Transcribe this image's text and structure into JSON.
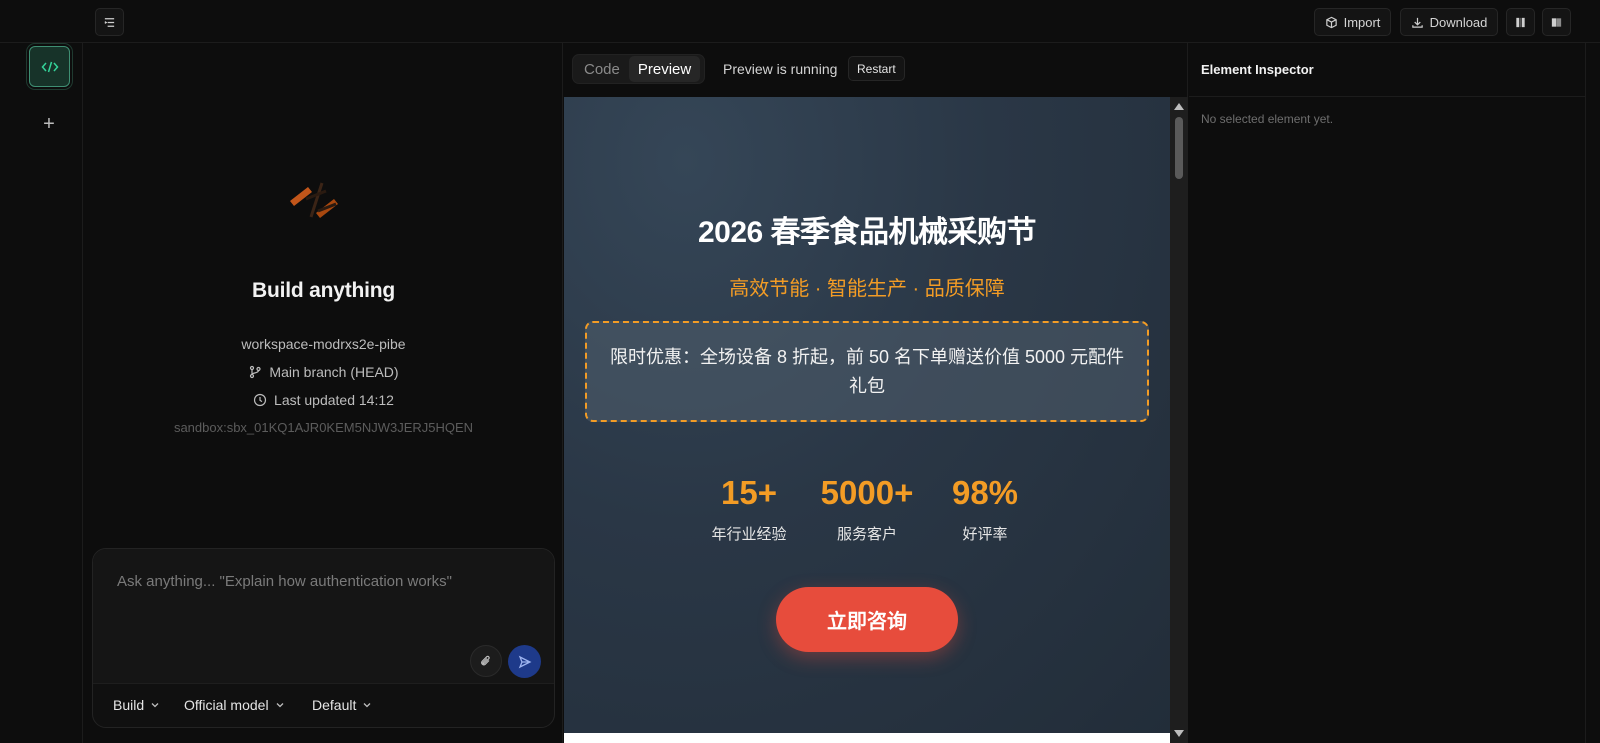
{
  "topbar": {
    "import_label": "Import",
    "download_label": "Download"
  },
  "chat": {
    "title": "Build anything",
    "workspace": "workspace-modrxs2e-pibe",
    "branch": "Main branch (HEAD)",
    "last_updated": "Last updated 14:12",
    "sandbox": "sandbox:sbx_01KQ1AJR0KEM5NJW3JERJ5HQEN",
    "composer_placeholder": "Ask anything... \"Explain how authentication works\"",
    "mode_label": "Build",
    "model_label": "Official model",
    "profile_label": "Default"
  },
  "preview": {
    "tabs": [
      "Code",
      "Preview"
    ],
    "active_tab": "Preview",
    "status": "Preview is running",
    "restart_label": "Restart"
  },
  "page": {
    "title": "2026 春季食品机械采购节",
    "subtitle": "高效节能 · 智能生产 · 品质保障",
    "promo": "限时优惠：全场设备 8 折起，前 50 名下单赠送价值 5000 元配件礼包",
    "stats": [
      {
        "value": "15+",
        "label": "年行业经验"
      },
      {
        "value": "5000+",
        "label": "服务客户"
      },
      {
        "value": "98%",
        "label": "好评率"
      }
    ],
    "cta_label": "立即咨询"
  },
  "inspector": {
    "title": "Element Inspector",
    "empty_text": "No selected element yet."
  },
  "colors": {
    "accent_orange": "#f39c25",
    "cta_red": "#e74c3c",
    "active_green": "#3f8f73",
    "send_blue": "#1e3a8a"
  }
}
